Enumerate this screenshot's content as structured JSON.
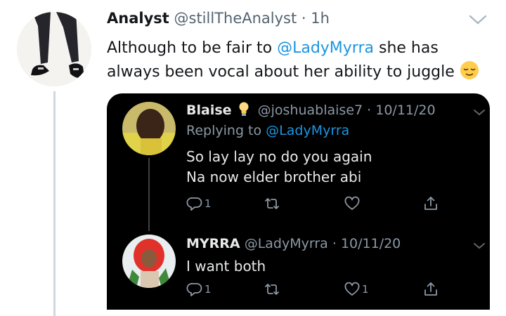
{
  "tweet": {
    "author_name": "Analyst",
    "handle": "@stillTheAnalyst",
    "separator": "·",
    "time": "1h",
    "text_part1": "Although to be fair to ",
    "mention": "@LadyMyrra",
    "text_part2": " she has always been vocal about her ability to juggle",
    "emoji_icon": "relieved-face-emoji"
  },
  "quoted_replies": [
    {
      "author_name": "Blaise",
      "handle": "@joshuablaise7",
      "separator": "·",
      "date": "10/11/20",
      "replying_label": "Replying to",
      "replying_mention": "@LadyMyrra",
      "text_line1": "So lay lay no do you again",
      "text_line2": "Na now elder brother abi",
      "reply_count": "1",
      "retweet_count": "",
      "like_count": ""
    },
    {
      "author_name": "MYRRA",
      "handle": "@LadyMyrra",
      "separator": "·",
      "date": "10/11/20",
      "text_line1": "I want both",
      "reply_count": "1",
      "retweet_count": "",
      "like_count": "1"
    }
  ],
  "colors": {
    "accent": "#1b95e0",
    "card_background": "#000000",
    "muted": "#8b98a5"
  }
}
